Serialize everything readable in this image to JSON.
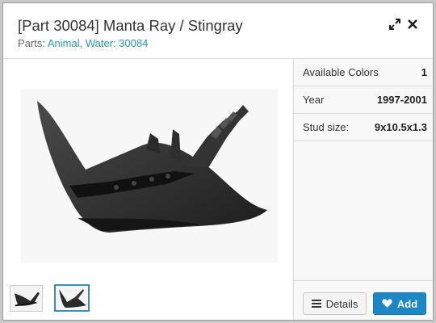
{
  "header": {
    "title": "[Part 30084] Manta Ray / Stingray",
    "subtitle_prefix": "Parts: ",
    "subtitle_link1": "Animal",
    "subtitle_sep": ", ",
    "subtitle_link2": "Water: 30084",
    "expand_icon": "expand-icon",
    "close_icon": "close-icon"
  },
  "image": {
    "alt": "Manta Ray / Stingray",
    "thumbnails": [
      "thumbnail-1",
      "thumbnail-2"
    ],
    "selected_thumbnail": 2
  },
  "details": [
    {
      "label": "Available Colors",
      "value": "1"
    },
    {
      "label": "Year",
      "value": "1997-2001"
    },
    {
      "label": "Stud size:",
      "value": "9x10.5x1.3"
    }
  ],
  "buttons": {
    "details_label": "Details",
    "add_label": "Add"
  },
  "colors": {
    "link": "#2a9aa8",
    "add_button": "#1d87c6",
    "thumb_selected_border": "#3a8fb0"
  }
}
